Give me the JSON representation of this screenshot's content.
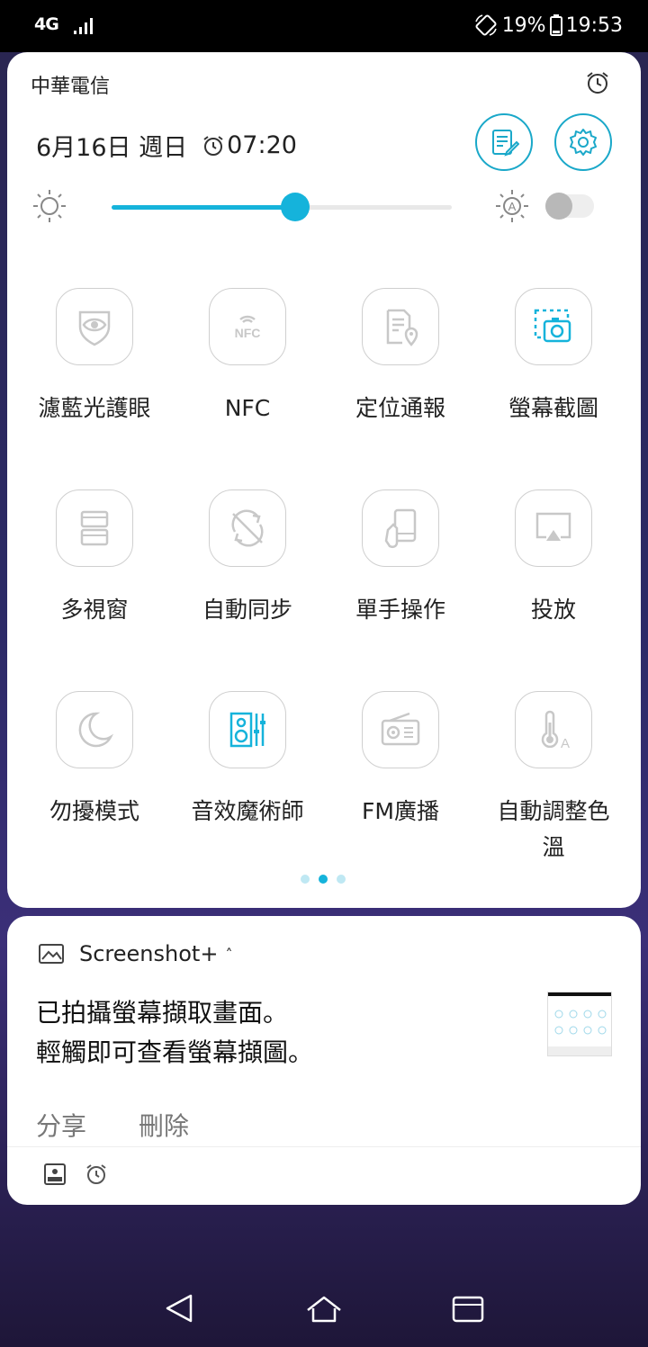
{
  "status": {
    "network": "4G",
    "battery": "19%",
    "time": "19:53"
  },
  "panel": {
    "carrier": "中華電信",
    "date": "6月16日 週日",
    "alarm_time": "07:20",
    "brightness_level": 0.54,
    "auto_brightness": false
  },
  "tiles": [
    {
      "label": "濾藍光護眼",
      "icon": "eye-shield-icon",
      "active": false
    },
    {
      "label": "NFC",
      "icon": "nfc-icon",
      "active": false
    },
    {
      "label": "定位通報",
      "icon": "location-report-icon",
      "active": false
    },
    {
      "label": "螢幕截圖",
      "icon": "screenshot-icon",
      "active": true
    },
    {
      "label": "多視窗",
      "icon": "multi-window-icon",
      "active": false
    },
    {
      "label": "自動同步",
      "icon": "sync-icon",
      "active": false
    },
    {
      "label": "單手操作",
      "icon": "one-hand-icon",
      "active": false
    },
    {
      "label": "投放",
      "icon": "cast-icon",
      "active": false
    },
    {
      "label": "勿擾模式",
      "icon": "moon-icon",
      "active": false
    },
    {
      "label": "音效魔術師",
      "icon": "speaker-eq-icon",
      "active": true
    },
    {
      "label": "FM廣播",
      "icon": "radio-icon",
      "active": false
    },
    {
      "label": "自動調整色溫",
      "icon": "thermometer-icon",
      "active": false
    }
  ],
  "page_dots": {
    "count": 3,
    "active": 1
  },
  "notification": {
    "app": "Screenshot+",
    "line1": "已拍攝螢幕擷取畫面。",
    "line2": "輕觸即可查看螢幕擷圖。",
    "action_share": "分享",
    "action_delete": "刪除"
  },
  "colors": {
    "accent": "#15b3db",
    "inactive_icon": "#c8c8c8"
  }
}
